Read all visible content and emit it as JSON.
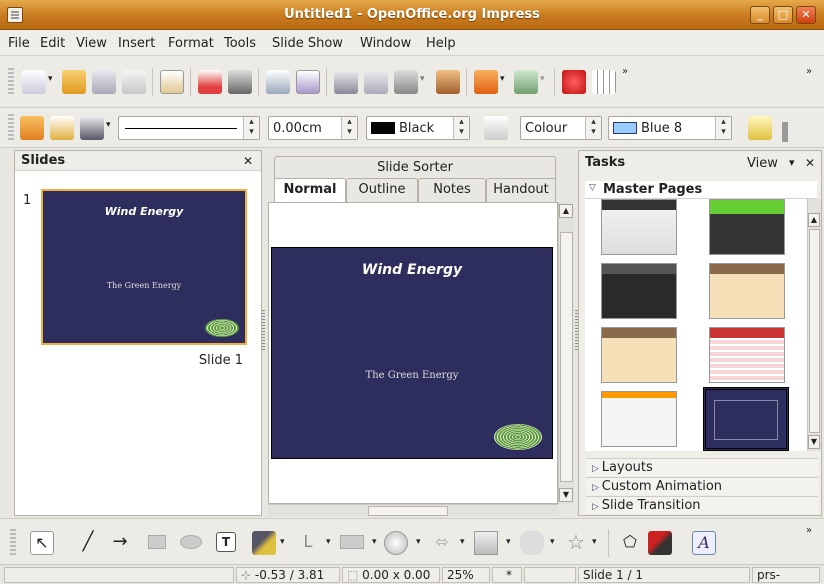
{
  "window": {
    "title": "Untitled1 - OpenOffice.org Impress",
    "btn_min": "_",
    "btn_max": "□",
    "btn_close": "✕"
  },
  "menu": [
    "File",
    "Edit",
    "View",
    "Insert",
    "Format",
    "Tools",
    "Slide Show",
    "Window",
    "Help"
  ],
  "formatting": {
    "line_width": "0.00cm",
    "line_color": "Black",
    "area_style": "Colour",
    "area_color": "Blue 8"
  },
  "slides_pane": {
    "title": "Slides",
    "close": "✕",
    "slide_number": "1",
    "slide_label": "Slide 1",
    "thumb_title": "Wind Energy",
    "thumb_subtitle": "The Green Energy"
  },
  "main": {
    "tab_sorter": "Slide Sorter",
    "tabs": [
      "Normal",
      "Outline",
      "Notes",
      "Handout"
    ],
    "slide_title": "Wind Energy",
    "slide_subtitle": "The Green Energy"
  },
  "tasks": {
    "title": "Tasks",
    "view_label": "View",
    "view_arrow": "▾",
    "close": "✕",
    "master_pages": "Master Pages",
    "layouts": "Layouts",
    "custom_animation": "Custom Animation",
    "slide_transition": "Slide Transition"
  },
  "status": {
    "position": "-0.53 / 3.81",
    "size": "0.00 x 0.00",
    "zoom": "25%",
    "modified": "*",
    "slide": "Slide 1 / 1",
    "master": "prs-strategy"
  },
  "colors": {
    "titlebar": "#c87b1e",
    "slide_bg": "#2d2d5e",
    "selection": "#f0b040"
  },
  "icons": [
    "new-icon",
    "open-icon",
    "save-icon",
    "email-icon",
    "edit-file-icon",
    "pdf-icon",
    "print-icon",
    "spellcheck-icon",
    "autospell-icon",
    "cut-icon",
    "copy-icon",
    "paste-icon",
    "format-paintbrush-icon",
    "undo-icon",
    "redo-icon",
    "chart-icon",
    "table-icon",
    "select-icon",
    "line-icon",
    "arrow-icon",
    "rectangle-icon",
    "ellipse-icon",
    "text-icon",
    "curve-icon",
    "connector-icon",
    "basic-shapes-icon",
    "symbol-shapes-icon",
    "block-arrows-icon",
    "flowchart-icon",
    "callouts-icon",
    "stars-icon",
    "points-icon",
    "glue-icon",
    "fontwork-icon"
  ]
}
